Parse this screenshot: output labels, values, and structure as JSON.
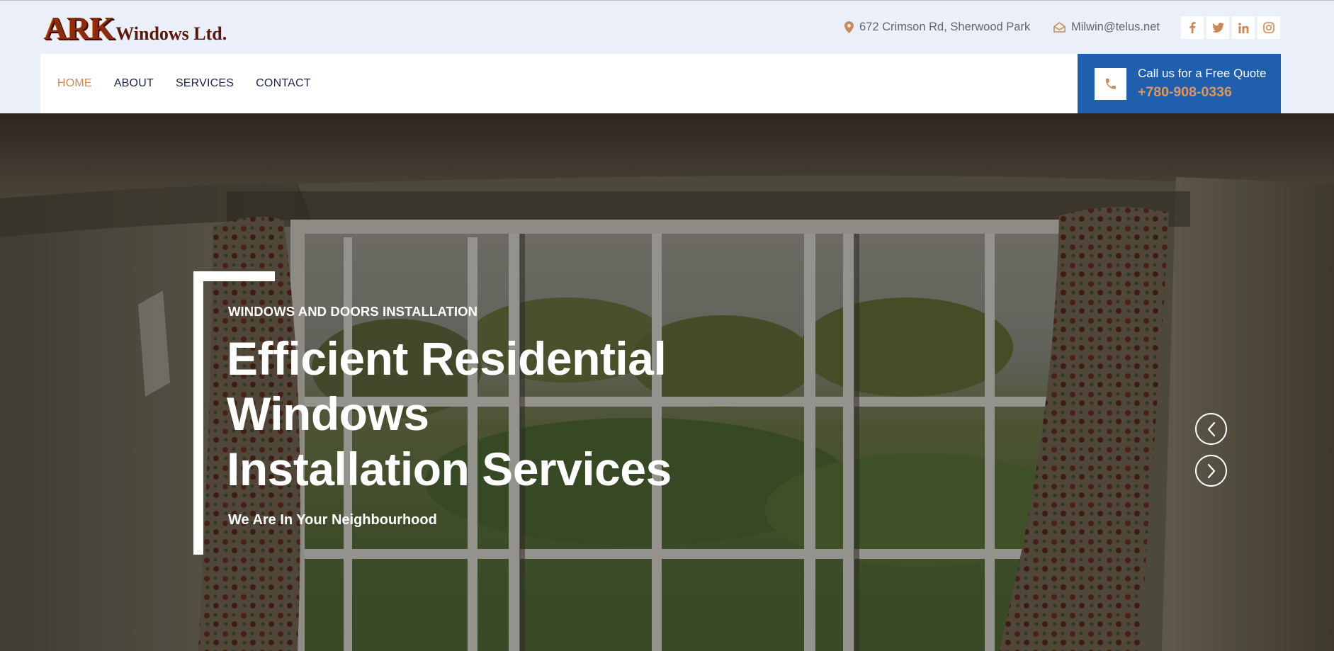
{
  "brand": {
    "logo_main": "ARK",
    "logo_rest": "Windows Ltd."
  },
  "topbar": {
    "address": "672 Crimson Rd, Sherwood Park",
    "email": "Milwin@telus.net",
    "socials": [
      {
        "icon": "facebook-icon",
        "glyph": "f"
      },
      {
        "icon": "twitter-icon",
        "glyph": "t"
      },
      {
        "icon": "linkedin-icon",
        "glyph": "in"
      },
      {
        "icon": "instagram-icon",
        "glyph": "ig"
      }
    ]
  },
  "nav": {
    "items": [
      {
        "label": "HOME",
        "active": true
      },
      {
        "label": "ABOUT",
        "active": false
      },
      {
        "label": "SERVICES",
        "active": false
      },
      {
        "label": "CONTACT",
        "active": false
      }
    ]
  },
  "quote": {
    "label": "Call us for a Free Quote",
    "phone": "+780-908-0336",
    "icon": "phone-icon"
  },
  "hero": {
    "eyebrow": "WINDOWS AND DOORS INSTALLATION",
    "headline": "Efficient Residential Windows Installation Services",
    "tagline": "We Are In Your Neighbourhood",
    "prev_icon": "chevron-left-icon",
    "next_icon": "chevron-right-icon"
  },
  "colors": {
    "accent": "#c88a56",
    "nav_text": "#202647",
    "quote_bg": "#1f5fad",
    "topbar_bg": "#eaeff9"
  }
}
